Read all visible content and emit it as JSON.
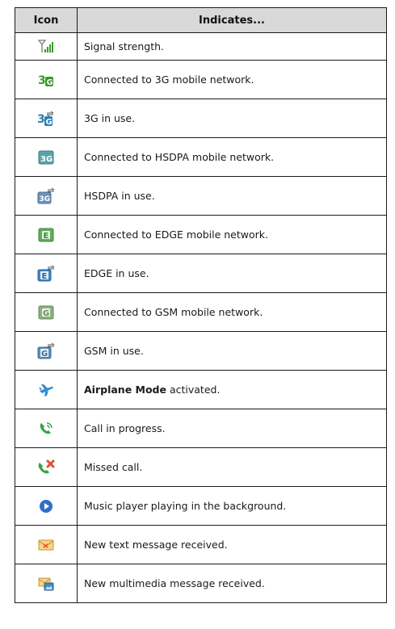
{
  "table": {
    "headers": {
      "icon": "Icon",
      "indicates": "Indicates..."
    },
    "rows": [
      {
        "icon": "signal-strength-icon",
        "text": "Signal strength."
      },
      {
        "icon": "3g-connected-icon",
        "text": "Connected to 3G mobile network."
      },
      {
        "icon": "3g-in-use-icon",
        "text": "3G in use."
      },
      {
        "icon": "hsdpa-connected-icon",
        "text": "Connected to HSDPA mobile network."
      },
      {
        "icon": "hsdpa-in-use-icon",
        "text": "HSDPA in use."
      },
      {
        "icon": "edge-connected-icon",
        "text": "Connected to EDGE mobile network."
      },
      {
        "icon": "edge-in-use-icon",
        "text": "EDGE in use."
      },
      {
        "icon": "gsm-connected-icon",
        "text": "Connected to GSM mobile network."
      },
      {
        "icon": "gsm-in-use-icon",
        "text": "GSM in use."
      },
      {
        "icon": "airplane-icon",
        "text_bold": "Airplane Mode",
        "text": " activated."
      },
      {
        "icon": "call-in-progress-icon",
        "text": "Call in progress."
      },
      {
        "icon": "missed-call-icon",
        "text": "Missed call."
      },
      {
        "icon": "music-play-icon",
        "text": "Music player playing in the background."
      },
      {
        "icon": "text-message-icon",
        "text": "New text message received."
      },
      {
        "icon": "multimedia-message-icon",
        "text": "New multimedia message received."
      }
    ]
  }
}
